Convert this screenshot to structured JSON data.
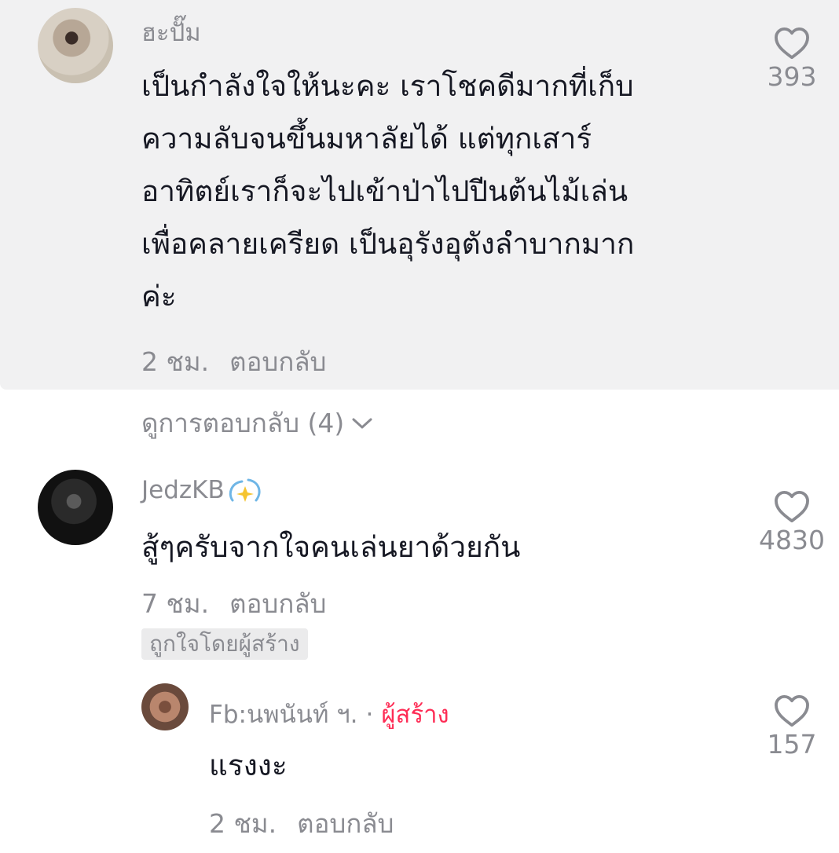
{
  "comments": [
    {
      "username": "ฮะปั๊ม",
      "lines": [
        "เป็นกำลังใจให้นะคะ เราโชคดีมากที่เก็บ",
        "ความลับจนขึ้นมหาลัยได้ แต่ทุกเสาร์",
        "อาทิตย์เราก็จะไปเข้าป่าไปปีนต้นไม้เล่น",
        "เพื่อคลายเครียด เป็นอุรังอุตังลำบากมาก",
        "ค่ะ"
      ],
      "time": "2 ชม.",
      "reply_label": "ตอบกลับ",
      "likes": "393",
      "view_replies": "ดูการตอบกลับ (4)"
    },
    {
      "username": "JedzKB",
      "text": "สู้ๆครับจากใจคนเล่นยาด้วยกัน",
      "time": "7 ชม.",
      "reply_label": "ตอบกลับ",
      "likes": "4830",
      "badge": "ถูกใจโดยผู้สร้าง"
    }
  ],
  "reply": {
    "username": "Fb:นพนันท์ ฯ.",
    "separator": "·",
    "creator_tag": "ผู้สร้าง",
    "text": "แรงงะ",
    "time": "2 ชม.",
    "reply_label": "ตอบกลับ",
    "likes": "157"
  },
  "colors": {
    "highlight_bg": "#f1f1f2",
    "text": "#161823",
    "muted": "#8a8b91",
    "creator_accent": "#fe2c55"
  },
  "icons": [
    "heart-outline-icon",
    "chevron-down-icon",
    "sparkle-emoji-icon"
  ]
}
